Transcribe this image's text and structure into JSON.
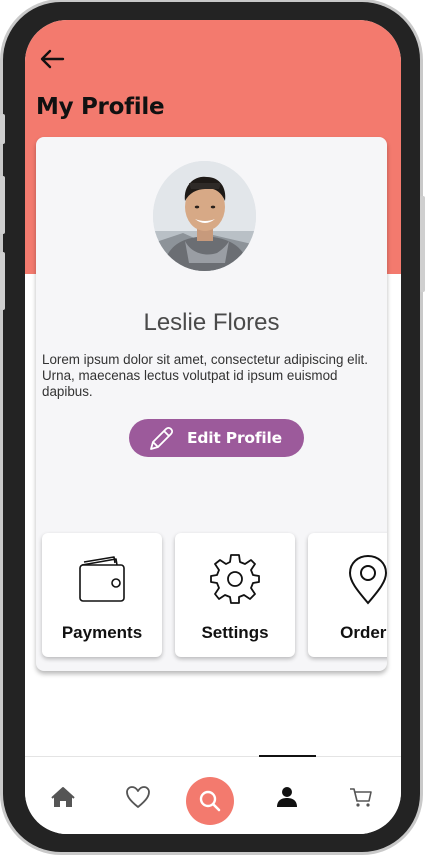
{
  "header": {
    "title": "My Profile",
    "back_icon": "arrow-left-icon"
  },
  "profile": {
    "name": "Leslie Flores",
    "bio": "Lorem ipsum dolor sit amet, consectetur adipiscing elit. Urna, maecenas lectus volutpat id ipsum euismod dapibus.",
    "edit_button": {
      "label": "Edit Profile",
      "icon": "pencil-icon"
    }
  },
  "tiles": [
    {
      "label": "Payments",
      "icon": "wallet-icon"
    },
    {
      "label": "Settings",
      "icon": "gear-icon"
    },
    {
      "label": "Orders",
      "icon": "location-pin-icon"
    }
  ],
  "bottom_nav": {
    "items": [
      {
        "id": "home",
        "icon": "home-icon"
      },
      {
        "id": "favorites",
        "icon": "heart-icon"
      },
      {
        "id": "search",
        "icon": "search-icon"
      },
      {
        "id": "profile",
        "icon": "user-icon",
        "active": true
      },
      {
        "id": "cart",
        "icon": "cart-icon"
      }
    ]
  },
  "colors": {
    "accent": "#f37a6e",
    "button": "#9c5a9b",
    "card": "#f6f6f8"
  }
}
